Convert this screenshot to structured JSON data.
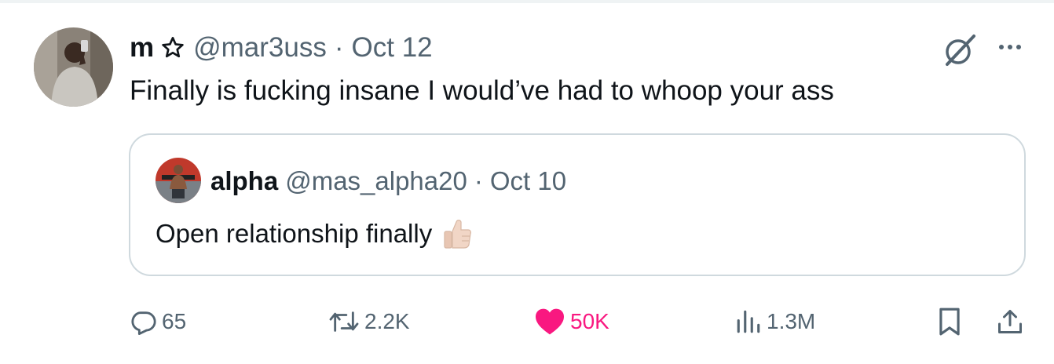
{
  "tweet": {
    "author_name": "m",
    "author_handle": "@mar3uss",
    "separator": "·",
    "date": "Oct 12",
    "text": "Finally is fucking insane I would’ve had to whoop your ass"
  },
  "quote": {
    "author_name": "alpha",
    "author_handle": "@mas_alpha20",
    "separator": "·",
    "date": "Oct 10",
    "text": "Open relationship finally",
    "emoji_icon": "thumbs-up-emoji"
  },
  "actions": {
    "replies": "65",
    "reposts": "2.2K",
    "likes": "50K",
    "views": "1.3M"
  },
  "colors": {
    "text": "#0f1419",
    "secondary": "#536471",
    "like": "#f91880",
    "border": "#cfd9de"
  }
}
